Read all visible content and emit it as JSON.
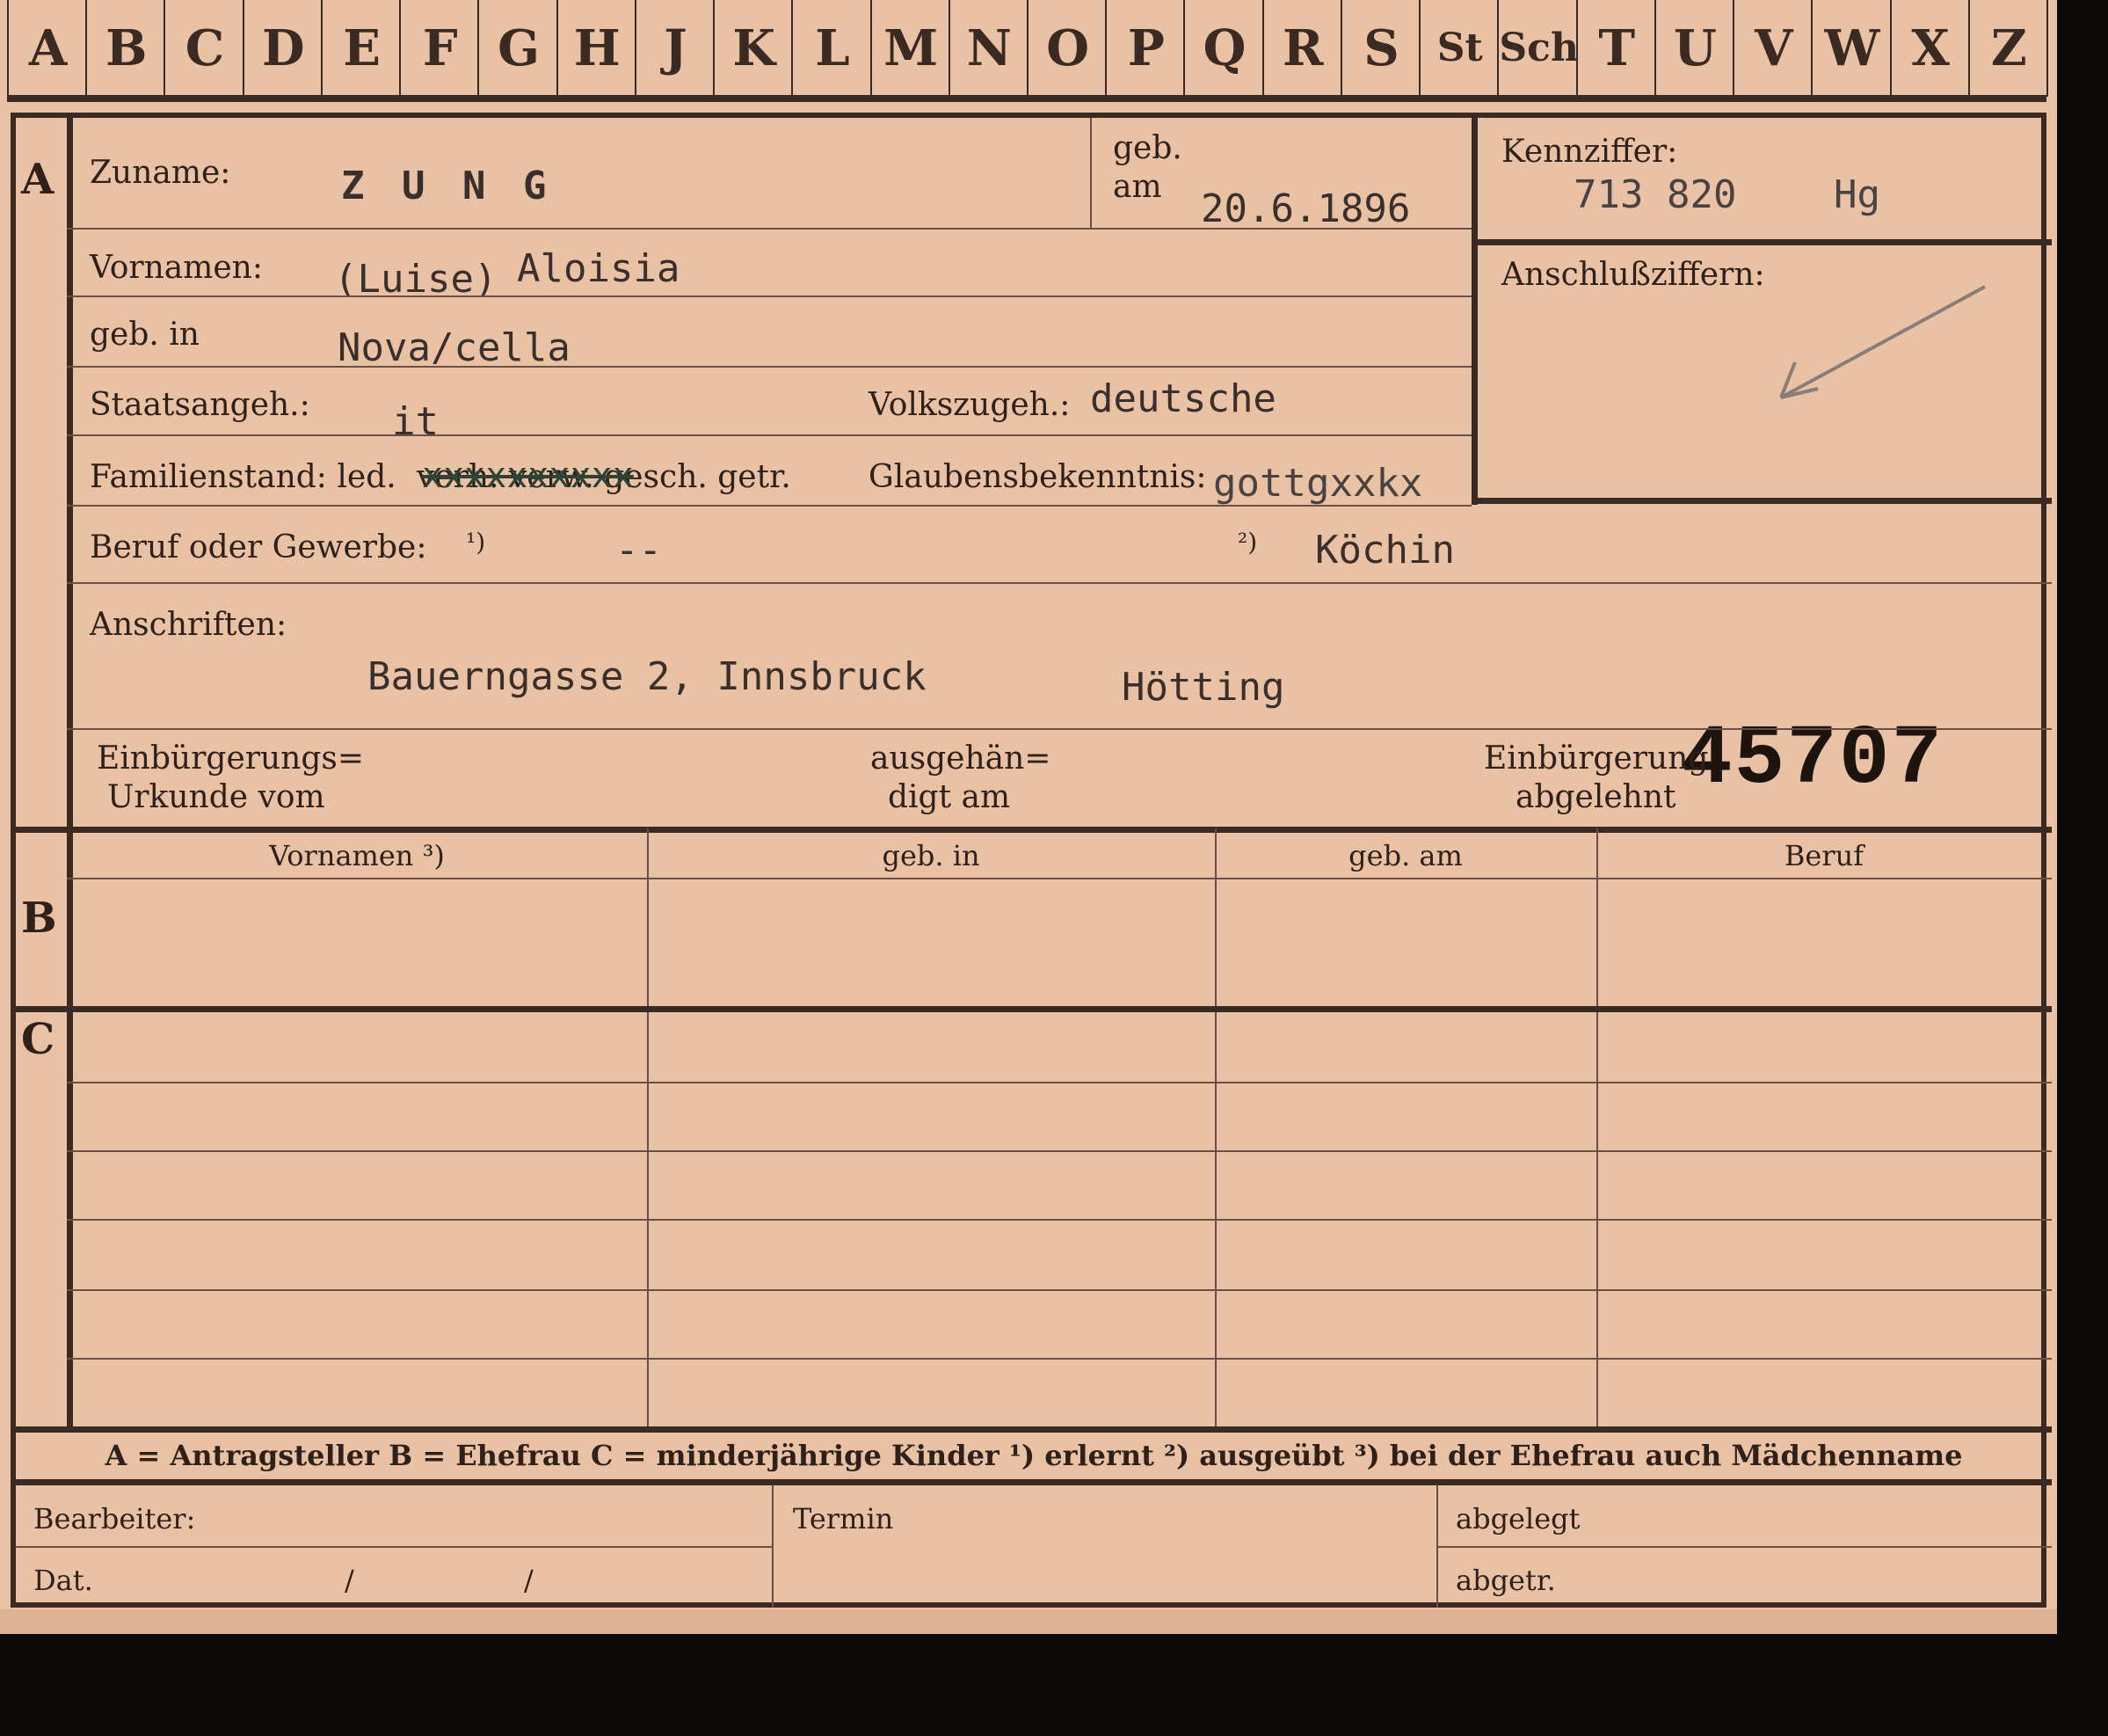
{
  "tabs": [
    "A",
    "B",
    "C",
    "D",
    "E",
    "F",
    "G",
    "H",
    "J",
    "K",
    "L",
    "M",
    "N",
    "O",
    "P",
    "Q",
    "R",
    "S",
    "St",
    "Sch",
    "T",
    "U",
    "V",
    "W",
    "X",
    "Z"
  ],
  "sections": {
    "a": "A",
    "b": "B",
    "c": "C"
  },
  "labels": {
    "surname": "Zuname:",
    "born_on_1": "geb.",
    "born_on_2": "am",
    "id_number": "Kennziffer:",
    "connection_numbers": "Anschlußziffern:",
    "given_names": "Vornamen:",
    "born_in": "geb. in",
    "citizenship": "Staatsangeh.:",
    "ethnicity": "Volkszugeh.:",
    "marital_status": "Familienstand: led.",
    "marital_struck": "verh. verw. gesch. getr.",
    "religion": "Glaubensbekenntnis:",
    "occupation": "Beruf oder Gewerbe:",
    "note1": "¹)",
    "note2": "²)",
    "addresses": "Anschriften:",
    "naturalization_cert_1": "Einbürgerungs=",
    "naturalization_cert_2": "Urkunde vom",
    "handed_out_1": "ausgehän=",
    "handed_out_2": "digt am",
    "naturalization_refused_1": "Einbürgerung",
    "naturalization_refused_2": "abgelehnt",
    "processor": "Bearbeiter:",
    "date": "Dat.",
    "date_sep1": "/",
    "date_sep2": "/",
    "deadline": "Termin",
    "filed": "abgelegt",
    "removed": "abgetr."
  },
  "columns": [
    "Vornamen ³)",
    "geb. in",
    "geb. am",
    "Beruf"
  ],
  "values": {
    "surname": "Z U N G",
    "birth_date": "20.6.1896",
    "id_number": "713 820",
    "id_suffix": "Hg",
    "given_names_paren": "(Luise)",
    "given_names": "Aloisia",
    "birthplace": "Nova/cella",
    "citizenship": "it",
    "ethnicity": "deutsche",
    "marital_typed": "xxxxxxxxxx",
    "religion": "gottgxxkx",
    "occupation_learned": "--",
    "occupation_practiced": "Köchin",
    "address": "Bauerngasse 2, Innsbruck",
    "district": "Hötting",
    "file_number": "45707"
  },
  "footer": "A = Antragsteller   B = Ehefrau   C = minderjährige Kinder   ¹) erlernt   ²) ausgeübt   ³) bei der Ehefrau auch Mädchenname",
  "colors": {
    "paper": "#e9c2a6",
    "ink": "#2f2119",
    "typewriter": "#3a2f2a",
    "pencil": "#8a7d78"
  }
}
